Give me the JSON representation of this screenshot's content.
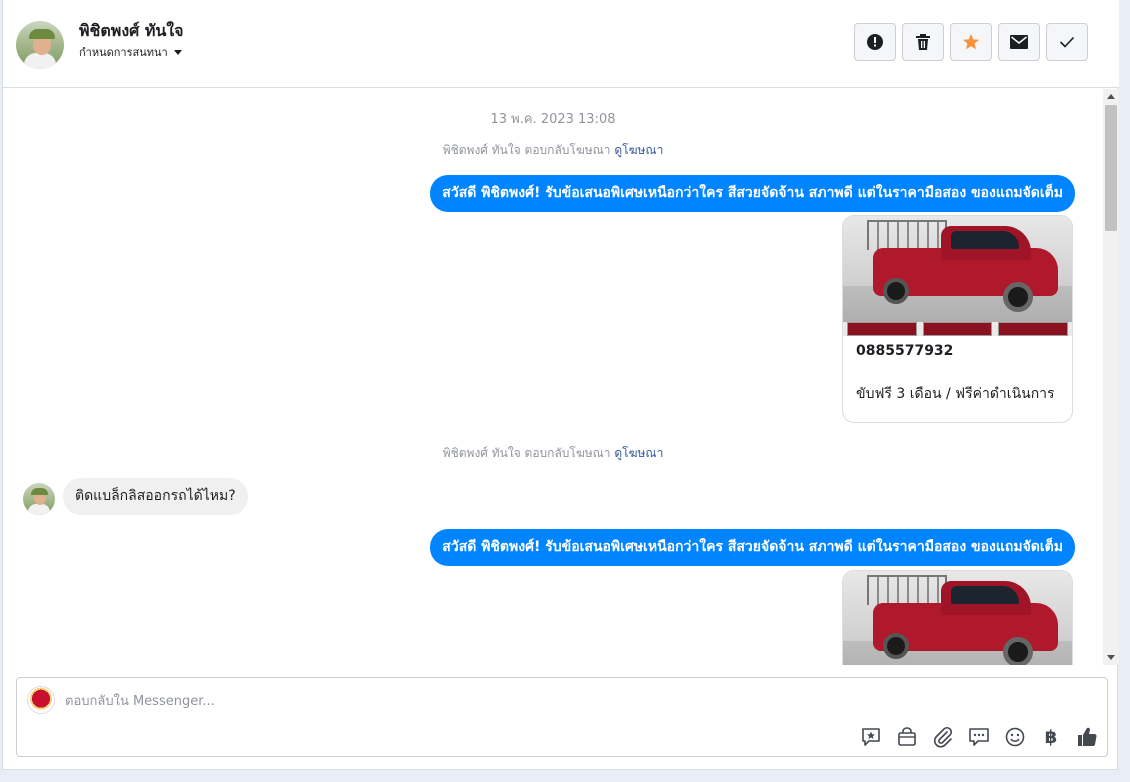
{
  "header": {
    "contact_name": "พิชิตพงศ์ ทันใจ",
    "status_label": "กำหนดการสนทนา",
    "actions": [
      {
        "name": "report",
        "icon": "exclamation-circle-icon"
      },
      {
        "name": "delete",
        "icon": "trash-icon"
      },
      {
        "name": "star",
        "icon": "star-icon",
        "color": "#f7923b"
      },
      {
        "name": "mark-unread",
        "icon": "envelope-icon"
      },
      {
        "name": "done",
        "icon": "check-icon"
      }
    ]
  },
  "conversation": {
    "timestamp": "13 พ.ค. 2023 13:08",
    "ad_reply_note": "พิชิตพงศ์ ทันใจ ตอบกลับโฆษณา",
    "ad_link_label": "ดูโฆษณา",
    "outgoing_message": "สวัสดี พิชิตพงศ์! รับข้อเสนอพิเศษเหนือกว่าใคร สีสวยจัดจ้าน สภาพดี แต่ในราคามือสอง ของแถมจัดเต็ม",
    "card": {
      "title": "0885577932",
      "subtitle": "ขับฟรี 3 เดือน / ฟรีค่าดำเนินการ"
    },
    "incoming_message": "ติดแบล็กลิสออกรถได้ไหม?"
  },
  "composer": {
    "placeholder": "ตอบกลับใน Messenger...",
    "tools": [
      "saved-reply-icon",
      "shop-bag-icon",
      "paperclip-icon",
      "chat-bubbles-icon",
      "smiley-icon",
      "baht-icon",
      "thumbs-up-icon"
    ],
    "baht_symbol": "฿"
  },
  "colors": {
    "accent": "#0084ff",
    "star": "#f7923b",
    "link": "#385898"
  }
}
